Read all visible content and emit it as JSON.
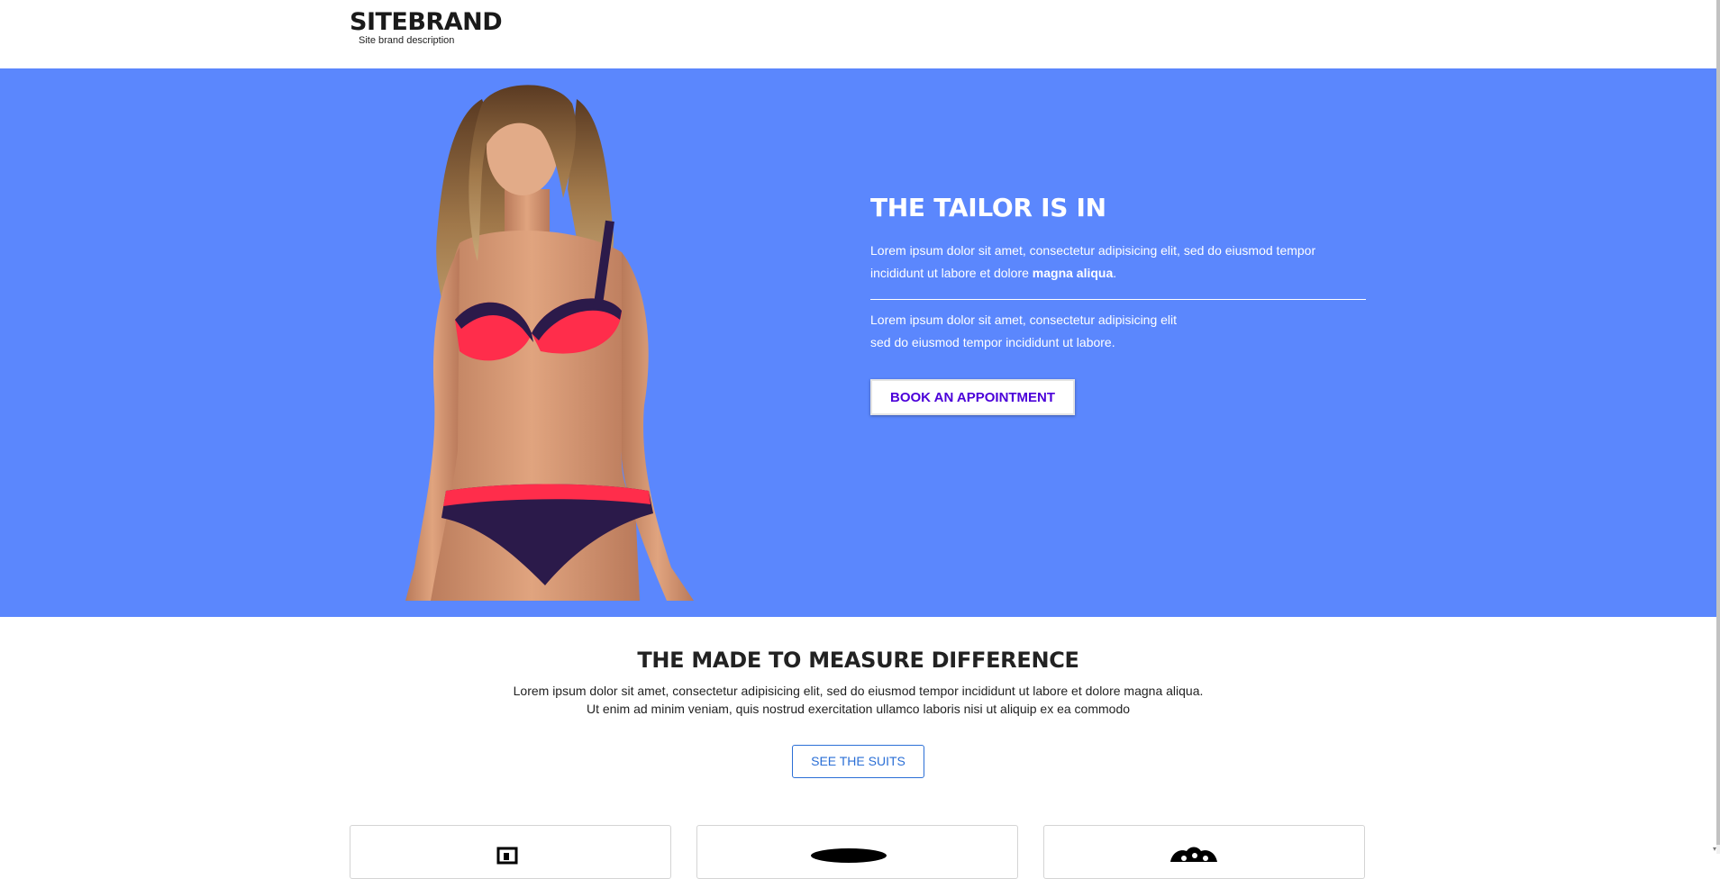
{
  "header": {
    "brand_title": "SITEBRAND",
    "brand_description": "Site brand description"
  },
  "hero": {
    "background_color": "#5b87fd",
    "title": "THE TAILOR IS IN",
    "paragraph1_text": "Lorem ipsum dolor sit amet, consectetur adipisicing elit, sed do eiusmod tempor incididunt ut labore et dolore ",
    "paragraph1_bold": "magna aliqua",
    "paragraph1_end": ".",
    "paragraph2_line1": "Lorem ipsum dolor sit amet, consectetur adipisicing elit",
    "paragraph2_line2": "sed do eiusmod tempor incididunt ut labore.",
    "cta_label": "BOOK AN APPOINTMENT",
    "cta_color": "#4b00d9"
  },
  "difference": {
    "title": "THE MADE TO MEASURE DIFFERENCE",
    "line1": "Lorem ipsum dolor sit amet, consectetur adipisicing elit, sed do eiusmod tempor incididunt ut labore et dolore magna aliqua.",
    "line2": "Ut enim ad minim veniam, quis nostrud exercitation ullamco laboris nisi ut aliquip ex ea commodo",
    "button_label": "SEE THE SUITS",
    "button_color": "#2b6fd6"
  },
  "cards": [
    {
      "icon": "frame-icon"
    },
    {
      "icon": "hat-icon"
    },
    {
      "icon": "buttons-icon"
    }
  ]
}
